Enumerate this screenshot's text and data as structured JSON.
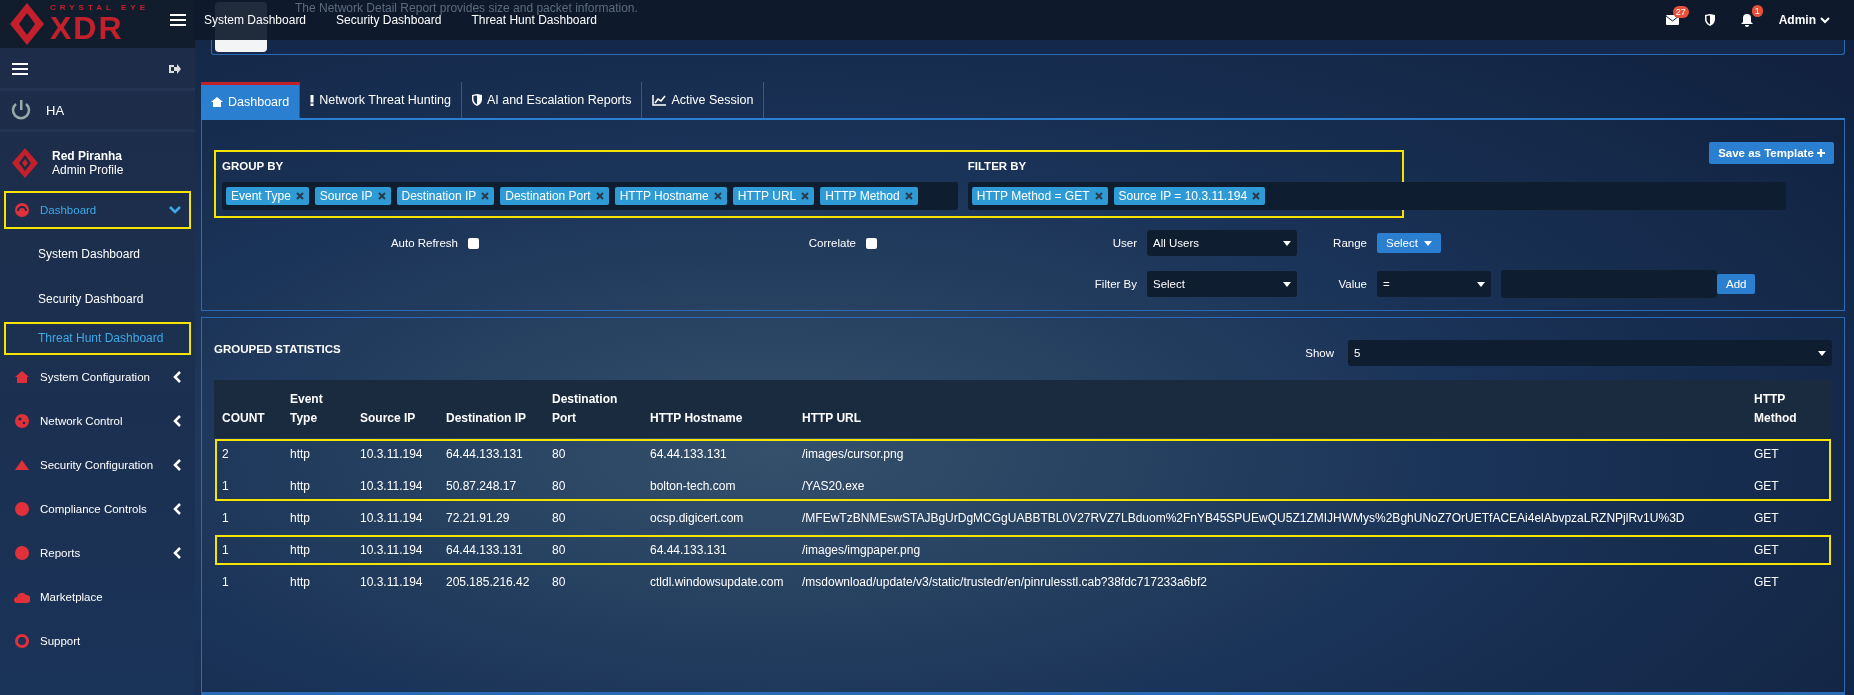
{
  "brand": {
    "line1": "CRYSTAL EYE",
    "line2": "XDR"
  },
  "topbar": {
    "nav": [
      "System Dashboard",
      "Security Dashboard",
      "Threat Hunt Dashboard"
    ],
    "mail_badge": "27",
    "alert_badge": "1",
    "user": "Admin"
  },
  "banner": {
    "text": "The Network Detail Report provides size and packet information."
  },
  "sidebar": {
    "ha": "HA",
    "profile": {
      "name": "Red Piranha",
      "role": "Admin Profile"
    },
    "items": [
      {
        "label": "Dashboard",
        "expanded": true,
        "highlighted": true,
        "children": [
          {
            "label": "System Dashboard",
            "selected": false,
            "highlighted": false
          },
          {
            "label": "Security Dashboard",
            "selected": false,
            "highlighted": false
          },
          {
            "label": "Threat Hunt Dashboard",
            "selected": true,
            "highlighted": true
          }
        ]
      },
      {
        "label": "System Configuration",
        "expanded": false,
        "highlighted": false
      },
      {
        "label": "Network Control",
        "expanded": false,
        "highlighted": false
      },
      {
        "label": "Security Configuration",
        "expanded": false,
        "highlighted": false
      },
      {
        "label": "Compliance Controls",
        "expanded": false,
        "highlighted": false
      },
      {
        "label": "Reports",
        "expanded": false,
        "highlighted": false
      },
      {
        "label": "Marketplace"
      },
      {
        "label": "Support"
      }
    ]
  },
  "tabs": [
    {
      "label": "Dashboard",
      "selected": true
    },
    {
      "label": "Network Threat Hunting",
      "selected": false
    },
    {
      "label": "AI and Escalation Reports",
      "selected": false
    },
    {
      "label": "Active Session",
      "selected": false
    }
  ],
  "criteria": {
    "highlighted": true,
    "group_by": {
      "title": "GROUP BY",
      "chips": [
        "Event Type",
        "Source IP",
        "Destination IP",
        "Destination Port",
        "HTTP Hostname",
        "HTTP URL",
        "HTTP Method"
      ]
    },
    "filter_by": {
      "title": "FILTER BY",
      "chips": [
        "HTTP Method = GET",
        "Source IP = 10.3.11.194"
      ]
    }
  },
  "save_button": "Save as Template",
  "controls": {
    "auto_refresh": {
      "label": "Auto Refresh",
      "checked": false
    },
    "correlate": {
      "label": "Correlate",
      "checked": false
    },
    "user": {
      "label": "User",
      "value": "All Users"
    },
    "range": {
      "label": "Range",
      "button": "Select"
    },
    "filter": {
      "label": "Filter By",
      "value": "Select"
    },
    "value": {
      "label": "Value",
      "operator": "="
    },
    "add_button": "Add"
  },
  "stats": {
    "title": "GROUPED STATISTICS",
    "show_label": "Show",
    "show_value": "5",
    "columns": [
      "COUNT",
      "Event Type",
      "Source IP",
      "Destination IP",
      "Destination Port",
      "HTTP Hostname",
      "HTTP URL",
      "HTTP Method"
    ],
    "row_groups": [
      {
        "highlighted": true,
        "rows": [
          [
            "2",
            "http",
            "10.3.11.194",
            "64.44.133.131",
            "80",
            "64.44.133.131",
            "/images/cursor.png",
            "GET"
          ],
          [
            "1",
            "http",
            "10.3.11.194",
            "50.87.248.17",
            "80",
            "bolton-tech.com",
            "/YAS20.exe",
            "GET"
          ]
        ]
      },
      {
        "highlighted": false,
        "rows": [
          [
            "1",
            "http",
            "10.3.11.194",
            "72.21.91.29",
            "80",
            "ocsp.digicert.com",
            "/MFEwTzBNMEswSTAJBgUrDgMCGgUABBTBL0V27RVZ7LBduom%2FnYB45SPUEwQU5Z1ZMIJHWMys%2BghUNoZ7OrUETfACEAi4elAbvpzaLRZNPjlRv1U%3D",
            "GET"
          ]
        ]
      },
      {
        "highlighted": true,
        "rows": [
          [
            "1",
            "http",
            "10.3.11.194",
            "64.44.133.131",
            "80",
            "64.44.133.131",
            "/images/imgpaper.png",
            "GET"
          ]
        ]
      },
      {
        "highlighted": false,
        "rows": [
          [
            "1",
            "http",
            "10.3.11.194",
            "205.185.216.42",
            "80",
            "ctldl.windowsupdate.com",
            "/msdownload/update/v3/static/trustedr/en/pinrulesstl.cab?38fdc717233a6bf2",
            "GET"
          ]
        ]
      }
    ]
  }
}
